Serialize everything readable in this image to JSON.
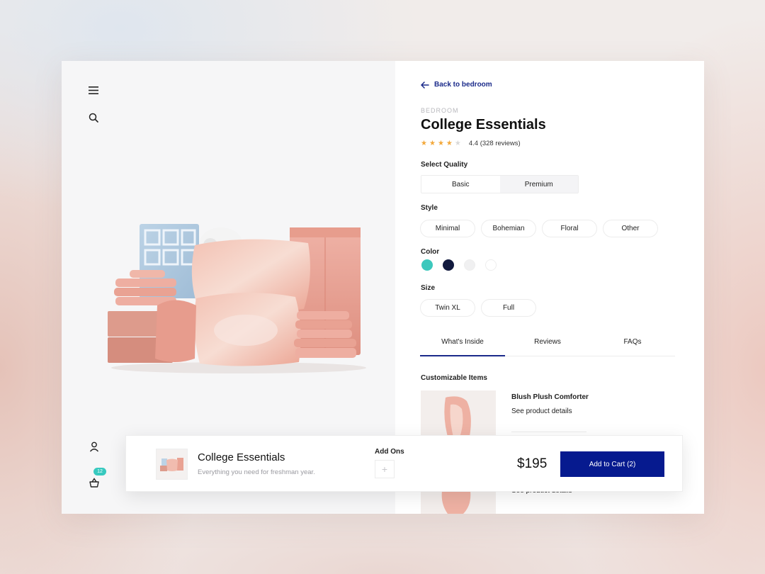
{
  "nav": {
    "menu_icon": "menu-icon",
    "search_icon": "search-icon",
    "user_icon": "user-icon",
    "basket_icon": "basket-icon",
    "basket_count": "12"
  },
  "product": {
    "back_label": "Back to bedroom",
    "category": "BEDROOM",
    "title": "College Essentials",
    "rating_value": 4.4,
    "rating_text": "4.4 (328 reviews)"
  },
  "quality": {
    "label": "Select Quality",
    "options": [
      "Basic",
      "Premium"
    ],
    "selected": "Premium"
  },
  "style": {
    "label": "Style",
    "options": [
      "Minimal",
      "Bohemian",
      "Floral",
      "Other"
    ]
  },
  "color": {
    "label": "Color",
    "swatches": [
      "#3cc8bd",
      "#121a3e",
      "#f0f0f1",
      "#ffffff"
    ]
  },
  "size": {
    "label": "Size",
    "options": [
      "Twin XL",
      "Full"
    ]
  },
  "tabs": {
    "items": [
      "What's Inside",
      "Reviews",
      "FAQs"
    ],
    "active": "What's Inside"
  },
  "inside": {
    "heading": "Customizable Items",
    "item1_name": "Blush Plush Comforter",
    "item1_link": "See product details",
    "item2_link": "See product details"
  },
  "cart_bar": {
    "title": "College Essentials",
    "subtitle": "Everything you need for freshman year.",
    "addons_label": "Add Ons",
    "addons_plus": "+",
    "price": "$195",
    "cart_button": "Add to Cart (2)"
  },
  "colors": {
    "accent": "#061a8f",
    "badge": "#37c9bf",
    "star": "#f3a83a"
  }
}
